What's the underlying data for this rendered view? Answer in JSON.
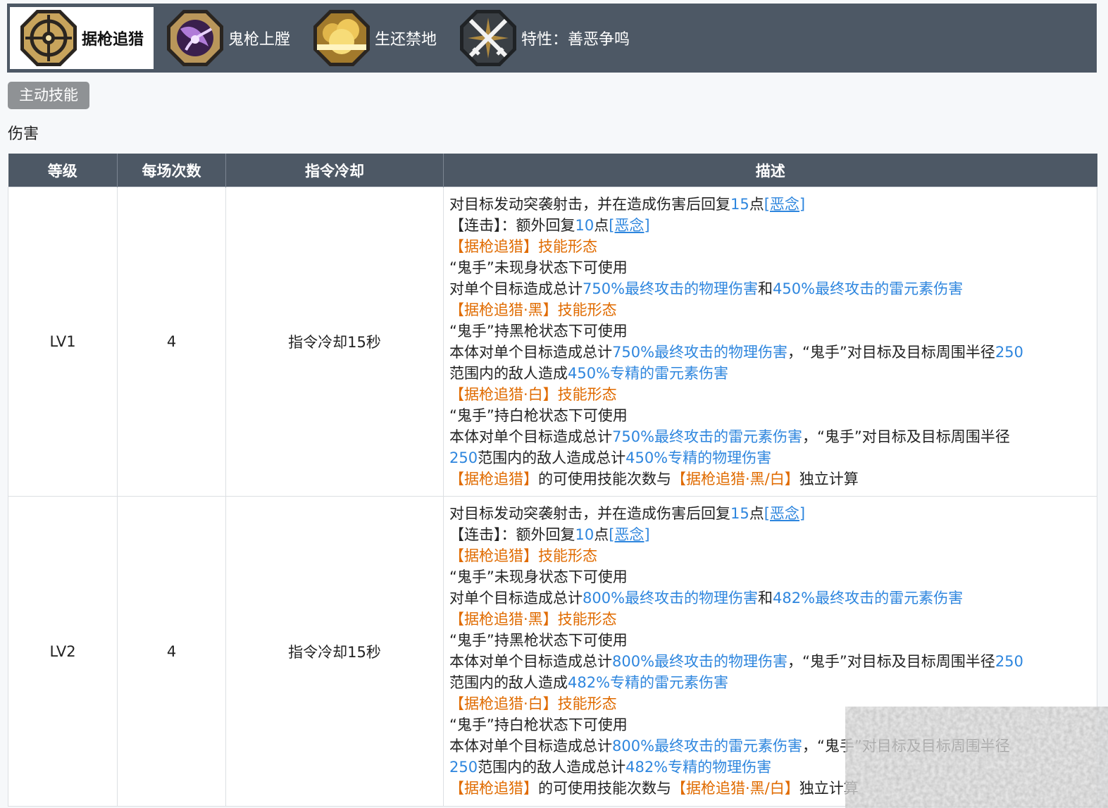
{
  "tabs": [
    {
      "label": "据枪追猎",
      "active": true,
      "icon": "crosshair-icon"
    },
    {
      "label": "鬼枪上膛",
      "active": false,
      "icon": "ghost-gun-icon"
    },
    {
      "label": "生还禁地",
      "active": false,
      "icon": "explosion-icon"
    },
    {
      "label": "特性：善恶争鸣",
      "active": false,
      "icon": "crossed-swords-icon"
    }
  ],
  "section": {
    "badge": "主动技能",
    "subtitle": "伤害"
  },
  "table": {
    "headers": [
      "等级",
      "每场次数",
      "指令冷却",
      "描述"
    ],
    "rows": [
      {
        "level": "LV1",
        "uses": "4",
        "cooldown": "指令冷却15秒",
        "desc": {
          "l1a": "对目标发动突袭射击，并在造成伤害后回复",
          "l1b": "15",
          "l1c": "点",
          "l1d": "[恶念]",
          "l2a": "【连击】：额外回复",
          "l2b": "10",
          "l2c": "点",
          "l2d": "[恶念]",
          "l3": "【据枪追猎】技能形态",
          "l4": "“鬼手”未现身状态下可使用",
          "l5a": "对单个目标造成总计",
          "l5b": "750%最终攻击的物理伤害",
          "l5c": "和",
          "l5d": "450%最终攻击的雷元素伤害",
          "l6": "【据枪追猎·黑】技能形态",
          "l7": "“鬼手”持黑枪状态下可使用",
          "l8a": "本体对单个目标造成总计",
          "l8b": "750%最终攻击的物理伤害",
          "l8c": "，“鬼手”对目标及目标周围半径",
          "l8d": "250",
          "l9a": "范围内的敌人造成",
          "l9b": "450%专精的雷元素伤害",
          "l10": "【据枪追猎·白】技能形态",
          "l11": "“鬼手”持白枪状态下可使用",
          "l12a": "本体对单个目标造成总计",
          "l12b": "750%最终攻击的雷元素伤害",
          "l12c": "，“鬼手”对目标及目标周围半径",
          "l13a": "250",
          "l13b": "范围内的敌人造成总计",
          "l13c": "450%专精的物理伤害",
          "l14a": "【据枪追猎】",
          "l14b": "的可使用技能次数与",
          "l14c": "【据枪追猎·黑/白】",
          "l14d": "独立计算"
        }
      },
      {
        "level": "LV2",
        "uses": "4",
        "cooldown": "指令冷却15秒",
        "desc": {
          "l1a": "对目标发动突袭射击，并在造成伤害后回复",
          "l1b": "15",
          "l1c": "点",
          "l1d": "[恶念]",
          "l2a": "【连击】：额外回复",
          "l2b": "10",
          "l2c": "点",
          "l2d": "[恶念]",
          "l3": "【据枪追猎】技能形态",
          "l4": "“鬼手”未现身状态下可使用",
          "l5a": "对单个目标造成总计",
          "l5b": "800%最终攻击的物理伤害",
          "l5c": "和",
          "l5d": "482%最终攻击的雷元素伤害",
          "l6": "【据枪追猎·黑】技能形态",
          "l7": "“鬼手”持黑枪状态下可使用",
          "l8a": "本体对单个目标造成总计",
          "l8b": "800%最终攻击的物理伤害",
          "l8c": "，“鬼手”对目标及目标周围半径",
          "l8d": "250",
          "l9a": "范围内的敌人造成",
          "l9b": "482%专精的雷元素伤害",
          "l10": "【据枪追猎·白】技能形态",
          "l11": "“鬼手”持白枪状态下可使用",
          "l12a": "本体对单个目标造成总计",
          "l12b": "800%最终攻击的雷元素伤害",
          "l12c": "，“鬼手”对目标及目标周围半径",
          "l13a": "250",
          "l13b": "范围内的敌人造成总计",
          "l13c": "482%专精的物理伤害",
          "l14a": "【据枪追猎】",
          "l14b": "的可使用技能次数与",
          "l14c": "【据枪追猎·黑/白】",
          "l14d": "独立计算"
        }
      }
    ]
  },
  "colors": {
    "header_bg": "#4d5865",
    "highlight": "#2e86de",
    "orange": "#e06b00",
    "badge_bg": "#8f9295"
  }
}
